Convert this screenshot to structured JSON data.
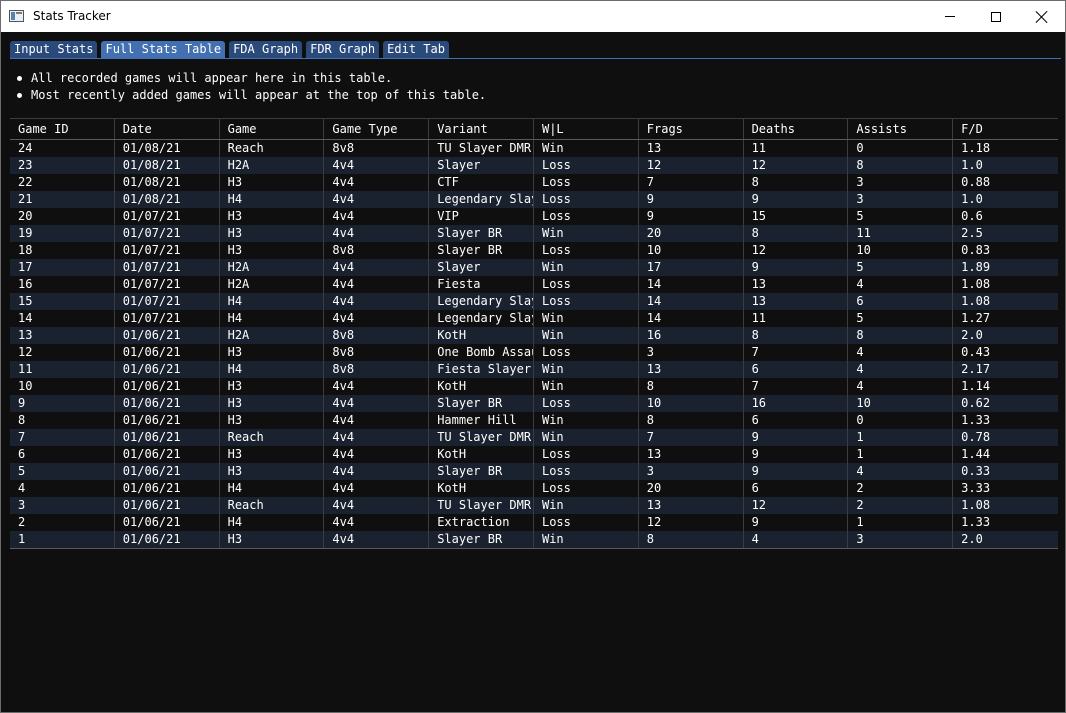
{
  "window": {
    "title": "Stats Tracker"
  },
  "tabs": [
    "Input Stats",
    "Full Stats Table",
    "FDA Graph",
    "FDR Graph",
    "Edit Tab"
  ],
  "active_tab": "Full Stats Table",
  "notes": [
    "All recorded games will appear here in this table.",
    "Most recently added games will appear at the top of this table."
  ],
  "table": {
    "columns": [
      "Game ID",
      "Date",
      "Game",
      "Game Type",
      "Variant",
      "W|L",
      "Frags",
      "Deaths",
      "Assists",
      "F/D"
    ],
    "rows": [
      [
        "24",
        "01/08/21",
        "Reach",
        "8v8",
        "TU Slayer DMR",
        "Win",
        "13",
        "11",
        "0",
        "1.18"
      ],
      [
        "23",
        "01/08/21",
        "H2A",
        "4v4",
        "Slayer",
        "Loss",
        "12",
        "12",
        "8",
        "1.0"
      ],
      [
        "22",
        "01/08/21",
        "H3",
        "4v4",
        "CTF",
        "Loss",
        "7",
        "8",
        "3",
        "0.88"
      ],
      [
        "21",
        "01/08/21",
        "H4",
        "4v4",
        "Legendary Slay",
        "Loss",
        "9",
        "9",
        "3",
        "1.0"
      ],
      [
        "20",
        "01/07/21",
        "H3",
        "4v4",
        "VIP",
        "Loss",
        "9",
        "15",
        "5",
        "0.6"
      ],
      [
        "19",
        "01/07/21",
        "H3",
        "4v4",
        "Slayer BR",
        "Win",
        "20",
        "8",
        "11",
        "2.5"
      ],
      [
        "18",
        "01/07/21",
        "H3",
        "8v8",
        "Slayer BR",
        "Loss",
        "10",
        "12",
        "10",
        "0.83"
      ],
      [
        "17",
        "01/07/21",
        "H2A",
        "4v4",
        "Slayer",
        "Win",
        "17",
        "9",
        "5",
        "1.89"
      ],
      [
        "16",
        "01/07/21",
        "H2A",
        "4v4",
        "Fiesta",
        "Loss",
        "14",
        "13",
        "4",
        "1.08"
      ],
      [
        "15",
        "01/07/21",
        "H4",
        "4v4",
        "Legendary Slay",
        "Loss",
        "14",
        "13",
        "6",
        "1.08"
      ],
      [
        "14",
        "01/07/21",
        "H4",
        "4v4",
        "Legendary Slay",
        "Win",
        "14",
        "11",
        "5",
        "1.27"
      ],
      [
        "13",
        "01/06/21",
        "H2A",
        "8v8",
        "KotH",
        "Win",
        "16",
        "8",
        "8",
        "2.0"
      ],
      [
        "12",
        "01/06/21",
        "H3",
        "8v8",
        "One Bomb Assau",
        "Loss",
        "3",
        "7",
        "4",
        "0.43"
      ],
      [
        "11",
        "01/06/21",
        "H4",
        "8v8",
        "Fiesta Slayer",
        "Win",
        "13",
        "6",
        "4",
        "2.17"
      ],
      [
        "10",
        "01/06/21",
        "H3",
        "4v4",
        "KotH",
        "Win",
        "8",
        "7",
        "4",
        "1.14"
      ],
      [
        "9",
        "01/06/21",
        "H3",
        "4v4",
        "Slayer BR",
        "Loss",
        "10",
        "16",
        "10",
        "0.62"
      ],
      [
        "8",
        "01/06/21",
        "H3",
        "4v4",
        "Hammer Hill",
        "Win",
        "8",
        "6",
        "0",
        "1.33"
      ],
      [
        "7",
        "01/06/21",
        "Reach",
        "4v4",
        "TU Slayer DMR",
        "Win",
        "7",
        "9",
        "1",
        "0.78"
      ],
      [
        "6",
        "01/06/21",
        "H3",
        "4v4",
        "KotH",
        "Loss",
        "13",
        "9",
        "1",
        "1.44"
      ],
      [
        "5",
        "01/06/21",
        "H3",
        "4v4",
        "Slayer BR",
        "Loss",
        "3",
        "9",
        "4",
        "0.33"
      ],
      [
        "4",
        "01/06/21",
        "H4",
        "4v4",
        "KotH",
        "Loss",
        "20",
        "6",
        "2",
        "3.33"
      ],
      [
        "3",
        "01/06/21",
        "Reach",
        "4v4",
        "TU Slayer DMR",
        "Win",
        "13",
        "12",
        "2",
        "1.08"
      ],
      [
        "2",
        "01/06/21",
        "H4",
        "4v4",
        "Extraction",
        "Loss",
        "12",
        "9",
        "1",
        "1.33"
      ],
      [
        "1",
        "01/06/21",
        "H3",
        "4v4",
        "Slayer BR",
        "Win",
        "8",
        "4",
        "3",
        "2.0"
      ]
    ]
  }
}
